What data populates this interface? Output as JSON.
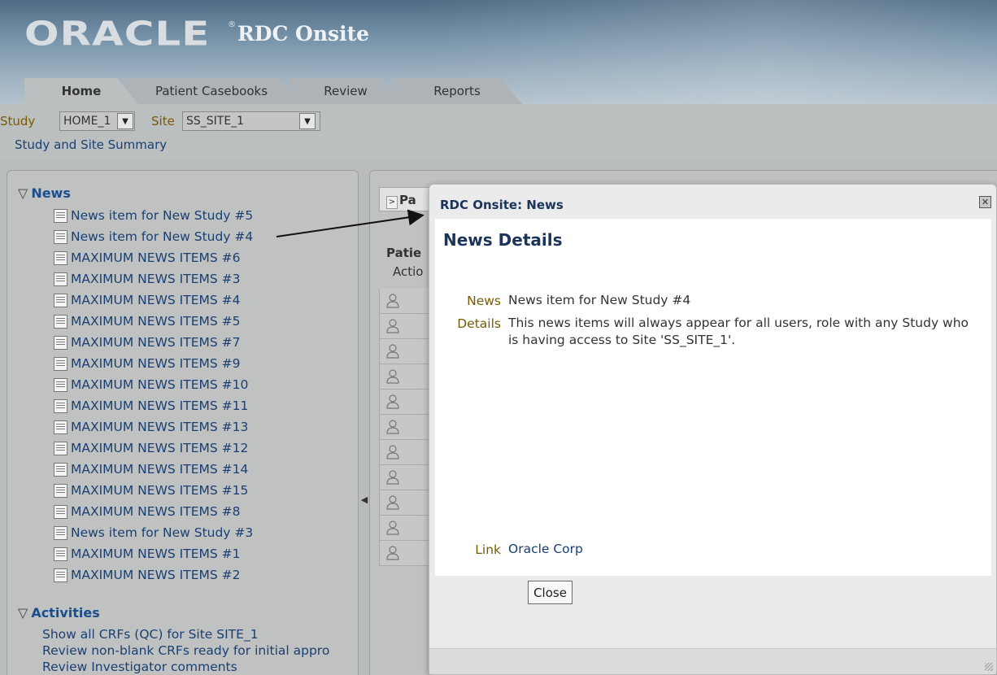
{
  "app": {
    "logo": "ORACLE",
    "logo_mark": "®",
    "product": "RDC Onsite"
  },
  "tabs": [
    {
      "label": "Home"
    },
    {
      "label": "Patient Casebooks"
    },
    {
      "label": "Review"
    },
    {
      "label": "Reports"
    }
  ],
  "context": {
    "study_label": "Study",
    "study_value": "HOME_1",
    "site_label": "Site",
    "site_value": "SS_SITE_1",
    "summary_link": "Study and Site Summary"
  },
  "left": {
    "news_title": "News",
    "news_items": [
      "News item for New Study #5",
      "News item for New Study #4",
      "MAXIMUM NEWS ITEMS #6",
      "MAXIMUM NEWS ITEMS #3",
      "MAXIMUM NEWS ITEMS #4",
      "MAXIMUM NEWS ITEMS #5",
      "MAXIMUM NEWS ITEMS #7",
      "MAXIMUM NEWS ITEMS #9",
      "MAXIMUM NEWS ITEMS #10",
      "MAXIMUM NEWS ITEMS #11",
      "MAXIMUM NEWS ITEMS #13",
      "MAXIMUM NEWS ITEMS #12",
      "MAXIMUM NEWS ITEMS #14",
      "MAXIMUM NEWS ITEMS #15",
      "MAXIMUM NEWS ITEMS #8",
      "News item for New Study #3",
      "MAXIMUM NEWS ITEMS #1",
      "MAXIMUM NEWS ITEMS #2"
    ],
    "activities_title": "Activities",
    "activities": [
      "Show all CRFs (QC) for Site SITE_1",
      "Review non-blank CRFs ready for initial appro",
      "Review Investigator comments"
    ]
  },
  "right": {
    "tab_label": "Pa",
    "panel_title": "Patie",
    "actions_label": "Actio"
  },
  "dialog": {
    "title": "RDC Onsite: News",
    "heading": "News Details",
    "news_label": "News",
    "news_value": "News item for New Study #4",
    "details_label": "Details",
    "details_value": "This news items will always appear for all users, role with any Study who is having access to Site 'SS_SITE_1'.",
    "link_label": "Link",
    "link_value": "Oracle Corp",
    "close_button": "Close"
  }
}
